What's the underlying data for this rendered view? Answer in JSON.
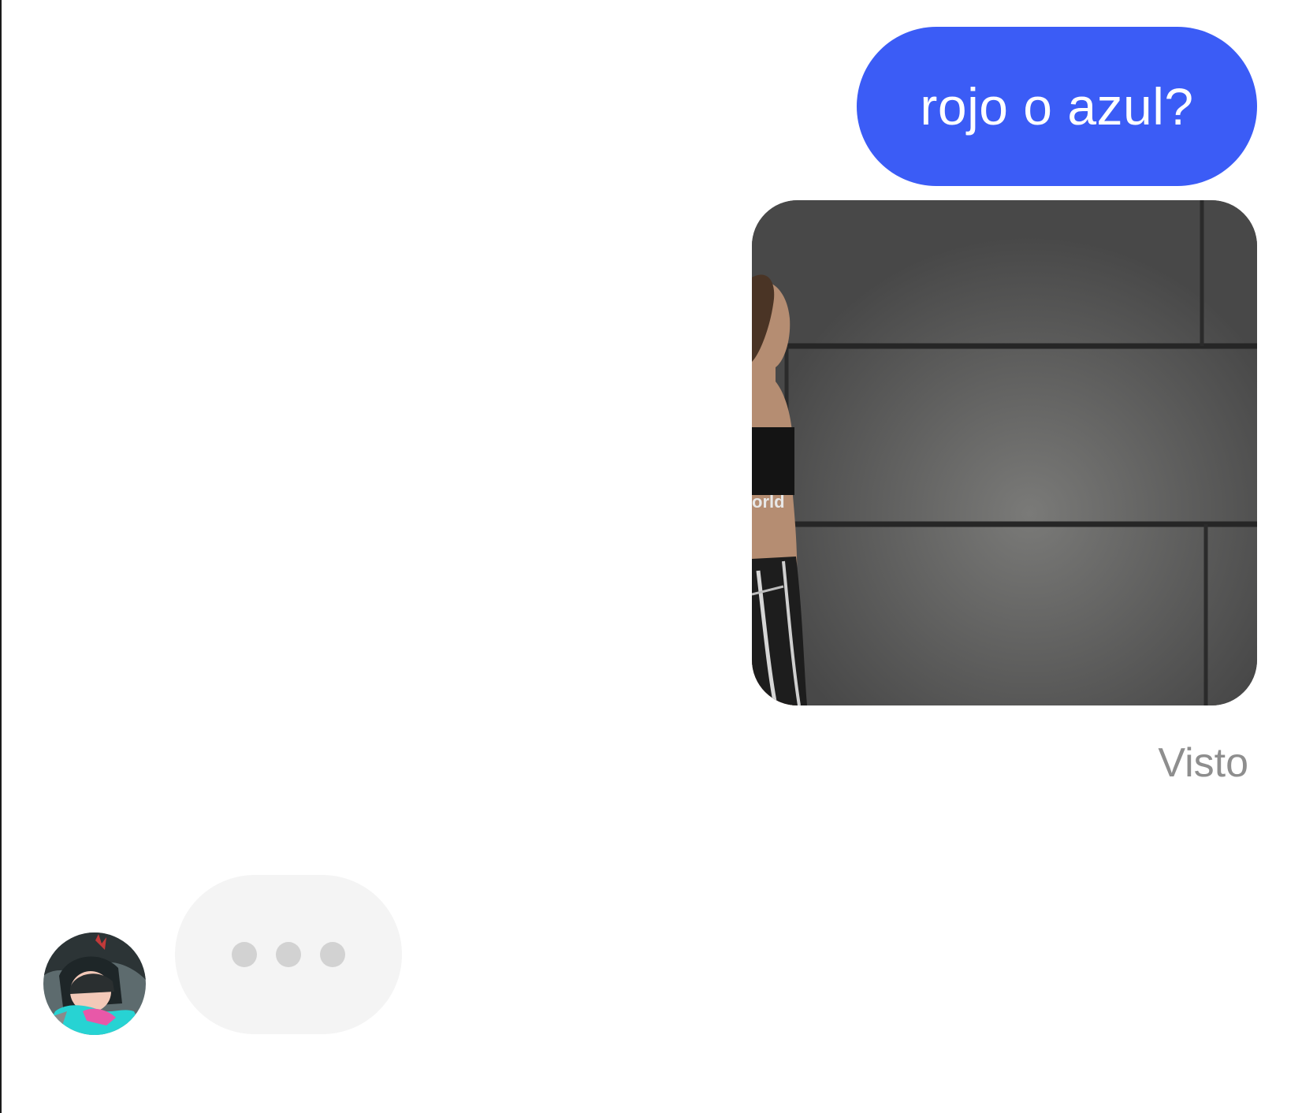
{
  "conversation": {
    "messages": [
      {
        "direction": "outgoing",
        "type": "text",
        "text": "rojo o azul?",
        "bubble_color": "#3b5cf6"
      },
      {
        "direction": "outgoing",
        "type": "video",
        "watermark_text": "orld"
      }
    ],
    "read_receipt": "Visto",
    "typing_indicator": {
      "visible": true,
      "dot_count": 3,
      "avatar_icon": "contact-avatar"
    }
  },
  "colors": {
    "outgoing_bubble": "#3b5cf6",
    "receipt_text": "#8e8e8e",
    "typing_bubble": "#f4f4f4",
    "typing_dots": "#d2d2d2"
  }
}
